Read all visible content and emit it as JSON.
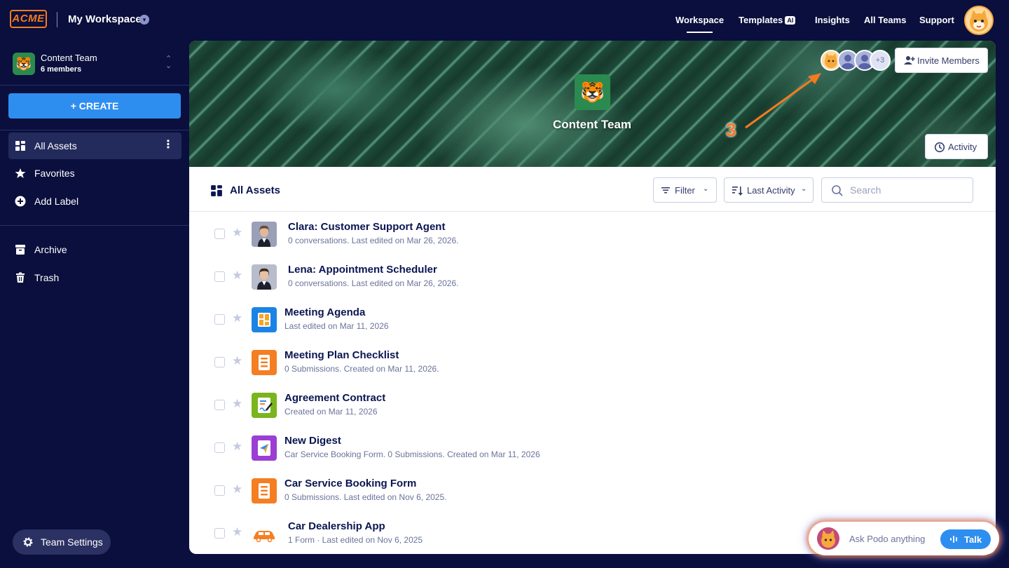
{
  "header": {
    "logo_text": "ACME",
    "workspace_title": "My Workspace",
    "nav": [
      {
        "label": "Workspace",
        "active": true
      },
      {
        "label": "Templates",
        "badge": "AI"
      },
      {
        "label": "Insights"
      },
      {
        "label": "All Teams"
      },
      {
        "label": "Support"
      }
    ]
  },
  "sidebar": {
    "team_name": "Content Team",
    "team_members": "6 members",
    "create_label": "+ CREATE",
    "items": [
      {
        "label": "All Assets",
        "active": true,
        "icon": "grid-icon"
      },
      {
        "label": "Favorites",
        "icon": "star-icon"
      },
      {
        "label": "Add Label",
        "icon": "plus-circle-icon"
      },
      {
        "label": "Archive",
        "icon": "archive-icon"
      },
      {
        "label": "Trash",
        "icon": "trash-icon"
      }
    ],
    "team_settings_label": "Team Settings"
  },
  "banner": {
    "team_title": "Content Team",
    "annotation_number": "3",
    "members_more": "+3",
    "invite_label": "Invite Members",
    "activity_label": "Activity"
  },
  "toolbar": {
    "title": "All Assets",
    "filter_label": "Filter",
    "sort_label": "Last Activity",
    "search_placeholder": "Search"
  },
  "assets": [
    {
      "title": "Clara: Customer Support Agent",
      "subtitle": "0 conversations. Last edited on Mar 26, 2026.",
      "type": "agent-female"
    },
    {
      "title": "Lena: Appointment Scheduler",
      "subtitle": "0 conversations. Last edited on Mar 26, 2026.",
      "type": "agent-female-2"
    },
    {
      "title": "Meeting Agenda",
      "subtitle": "Last edited on Mar 11, 2026",
      "type": "table"
    },
    {
      "title": "Meeting Plan Checklist",
      "subtitle": "0 Submissions.  Created on Mar 11, 2026.",
      "type": "form"
    },
    {
      "title": "Agreement Contract",
      "subtitle": "Created on Mar 11, 2026",
      "type": "sign"
    },
    {
      "title": "New Digest",
      "subtitle": "Car Service Booking Form. 0 Submissions. Created on Mar 11, 2026",
      "type": "digest"
    },
    {
      "title": "Car Service Booking Form",
      "subtitle": "0 Submissions.  Last edited on Nov 6, 2025.",
      "type": "form"
    },
    {
      "title": "Car Dealership App",
      "subtitle": "1 Form · Last edited on Nov 6, 2025",
      "type": "app"
    }
  ],
  "assistant": {
    "prompt": "Ask Podo anything",
    "talk_label": "Talk"
  },
  "colors": {
    "background": "#0a0f3d",
    "primary_blue": "#2e8ef0",
    "accent_orange": "#f47b20",
    "title_navy": "#0a1551"
  }
}
